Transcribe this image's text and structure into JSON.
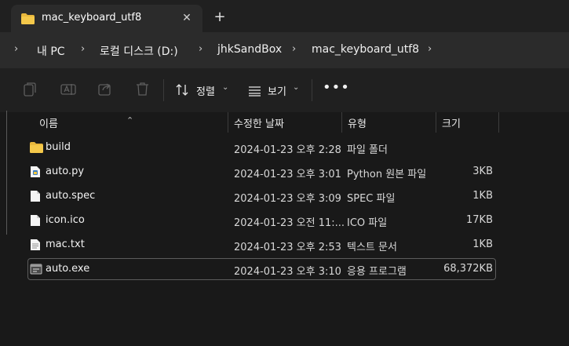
{
  "tab": {
    "title": "mac_keyboard_utf8",
    "close": "✕",
    "new": "+"
  },
  "breadcrumb": {
    "items": [
      "내 PC",
      "로컬 디스크 (D:)",
      "jhkSandBox",
      "mac_keyboard_utf8"
    ],
    "separator": "›"
  },
  "toolbar": {
    "sort_label": "정렬",
    "view_label": "보기",
    "more": "•••"
  },
  "columns": {
    "name": "이름",
    "date": "수정한 날짜",
    "type": "유형",
    "size": "크기"
  },
  "files": [
    {
      "name": "build",
      "date": "2024-01-23 오후 2:28",
      "type": "파일 폴더",
      "size": "",
      "icon": "folder-icon"
    },
    {
      "name": "auto.py",
      "date": "2024-01-23 오후 3:01",
      "type": "Python 원본 파일",
      "size": "3KB",
      "icon": "python-file-icon"
    },
    {
      "name": "auto.spec",
      "date": "2024-01-23 오후 3:09",
      "type": "SPEC 파일",
      "size": "1KB",
      "icon": "file-icon"
    },
    {
      "name": "icon.ico",
      "date": "2024-01-23 오전 11:...",
      "type": "ICO 파일",
      "size": "17KB",
      "icon": "file-icon"
    },
    {
      "name": "mac.txt",
      "date": "2024-01-23 오후 2:53",
      "type": "텍스트 문서",
      "size": "1KB",
      "icon": "text-file-icon"
    },
    {
      "name": "auto.exe",
      "date": "2024-01-23 오후 3:10",
      "type": "응용 프로그램",
      "size": "68,372KB",
      "icon": "exe-icon",
      "selected": true
    }
  ],
  "colors": {
    "folder": "#e8b73c",
    "background": "#191919",
    "tab_active": "#2b2b2b",
    "selection_border": "#5c5c5c"
  }
}
